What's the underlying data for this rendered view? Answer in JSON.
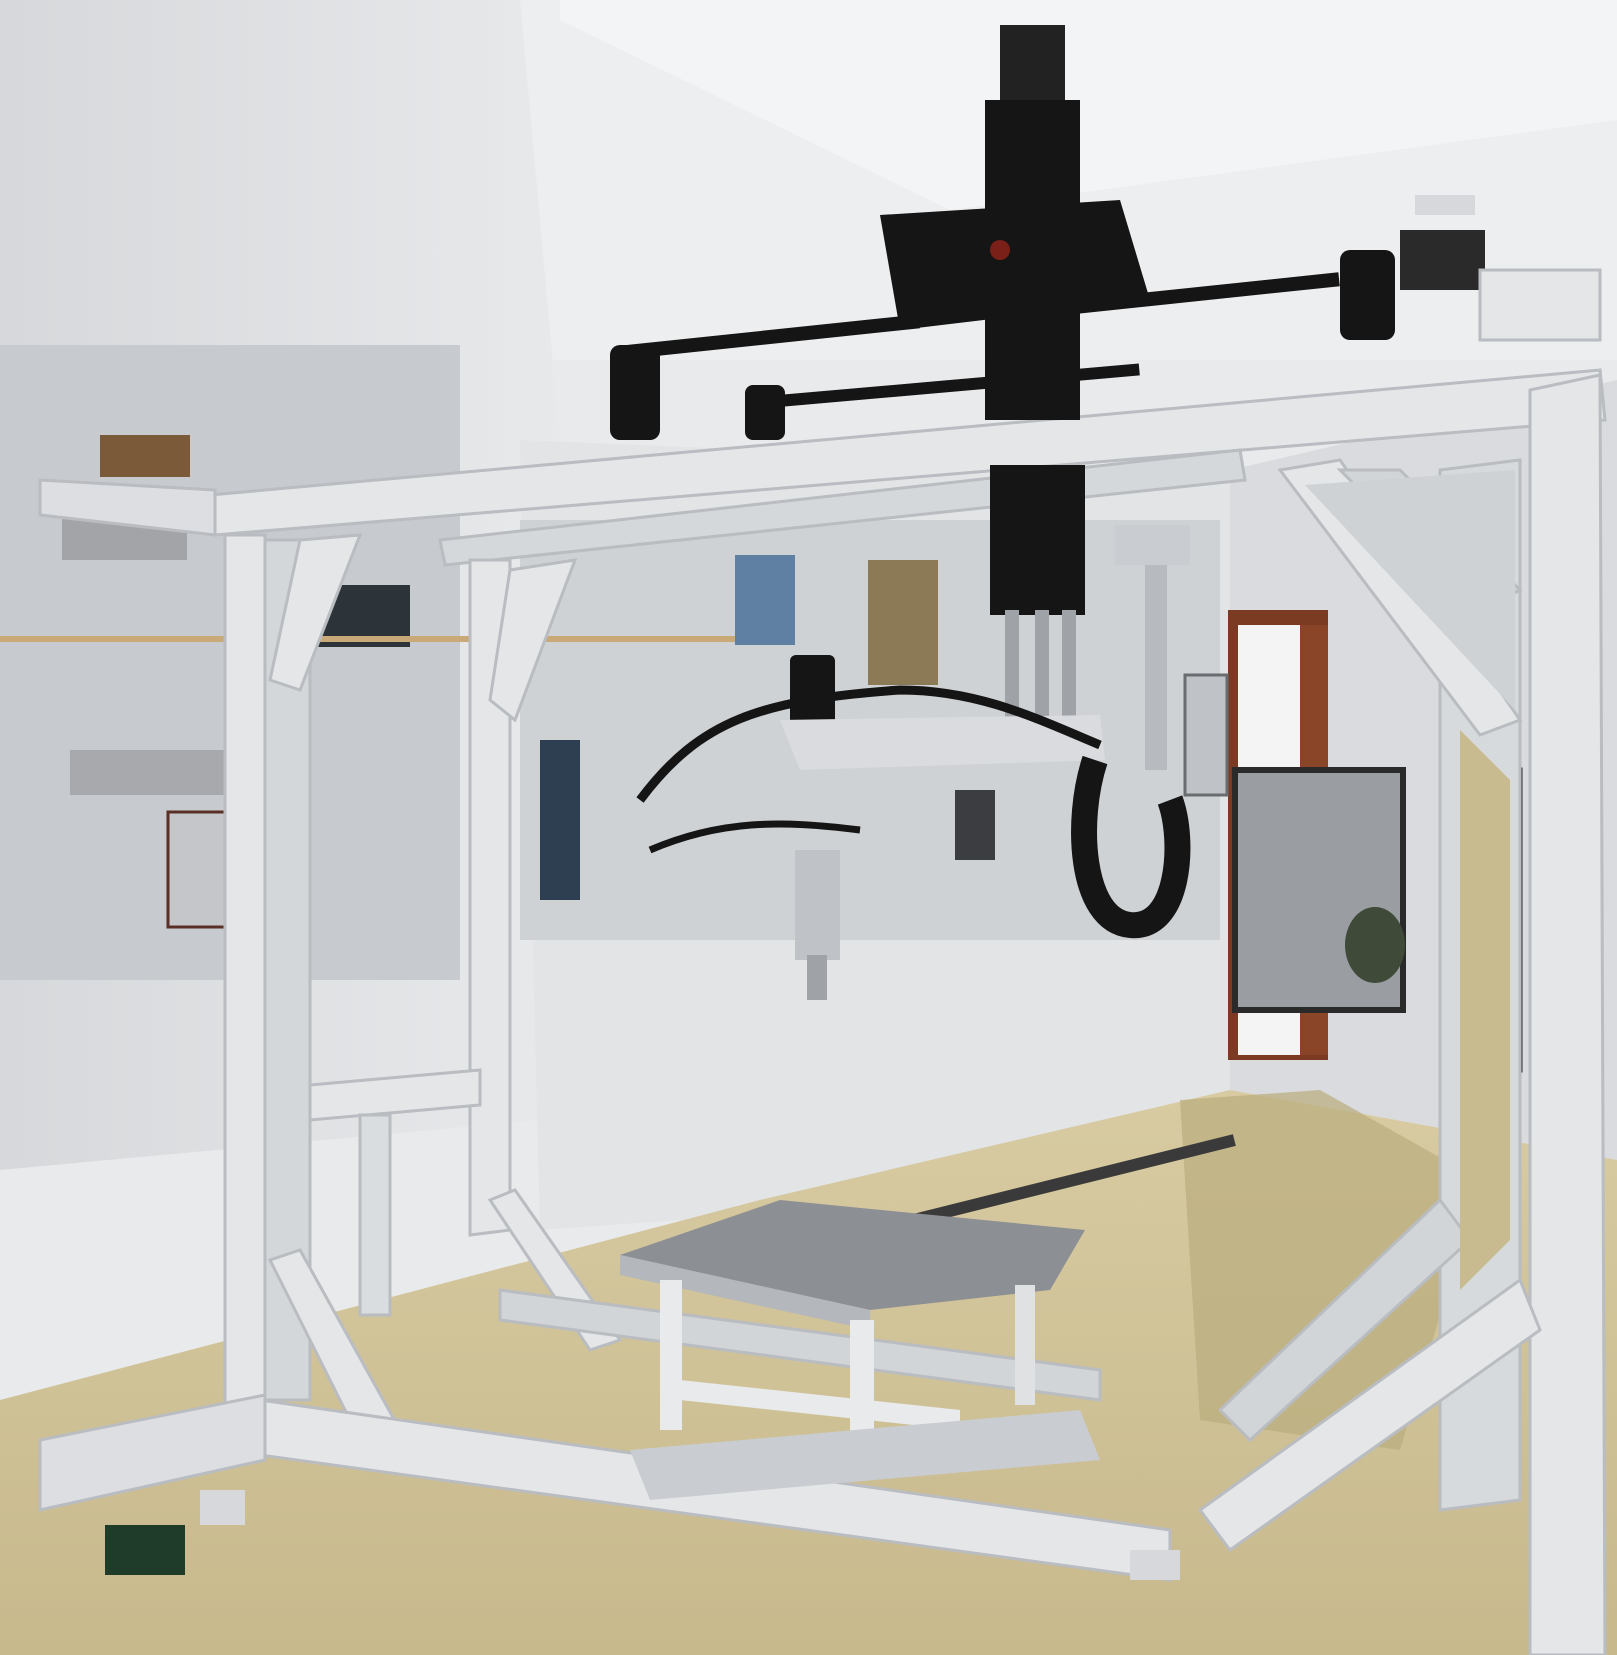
{
  "scene": {
    "subject": "gantry-robot-frame",
    "colors": {
      "wall": "#dfe1e4",
      "wall_shadow": "#c9ccd0",
      "ceiling": "#eceef0",
      "floor": "#cfc29a",
      "floor_dark": "#b7a87a",
      "frame": "#e4e6e8",
      "frame_edge": "#b9bcc0",
      "machine": "#151515",
      "door_wood": "#7a3b22",
      "doorway_light": "#f4f4f4",
      "fence": "#9a9da2",
      "table_top": "#8c8f93"
    }
  }
}
